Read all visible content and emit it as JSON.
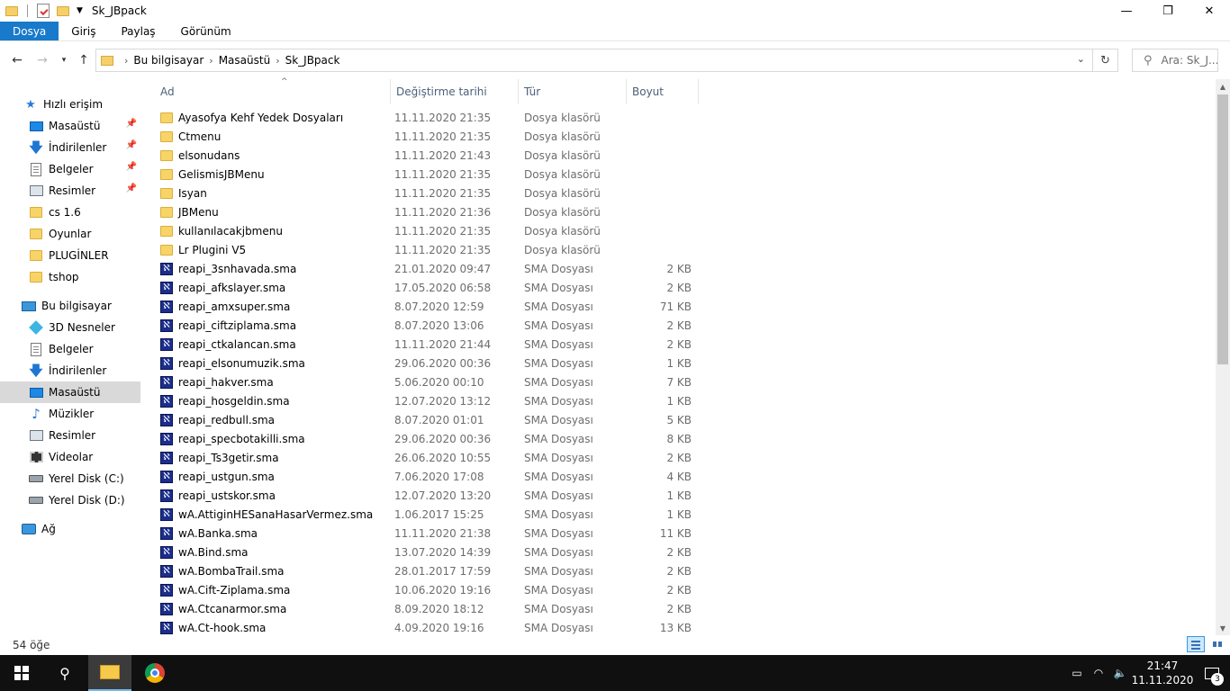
{
  "window": {
    "title": "Sk_JBpack",
    "minimize": "—",
    "maximize": "❐",
    "close": "✕"
  },
  "ribbon": {
    "tabs": [
      {
        "label": "Dosya",
        "active": true
      },
      {
        "label": "Giriş"
      },
      {
        "label": "Paylaş"
      },
      {
        "label": "Görünüm"
      }
    ]
  },
  "address": {
    "crumbs": [
      "Bu bilgisayar",
      "Masaüstü",
      "Sk_JBpack"
    ],
    "search_placeholder": "Ara: Sk_J..."
  },
  "nav": {
    "items": [
      {
        "label": "Hızlı erişim",
        "icon": "star-icon"
      },
      {
        "label": "Masaüstü",
        "icon": "desktop-icon",
        "pinned": true
      },
      {
        "label": "İndirilenler",
        "icon": "download-icon",
        "pinned": true
      },
      {
        "label": "Belgeler",
        "icon": "documents-icon",
        "pinned": true
      },
      {
        "label": "Resimler",
        "icon": "pictures-icon",
        "pinned": true
      },
      {
        "label": "cs 1.6",
        "icon": "folder-icon"
      },
      {
        "label": "Oyunlar",
        "icon": "folder-icon"
      },
      {
        "label": "PLUGİNLER",
        "icon": "folder-icon"
      },
      {
        "label": "tshop",
        "icon": "folder-icon"
      },
      {
        "label": "Bu bilgisayar",
        "icon": "computer-icon"
      },
      {
        "label": "3D Nesneler",
        "icon": "3d-objects-icon"
      },
      {
        "label": "Belgeler",
        "icon": "documents-icon"
      },
      {
        "label": "İndirilenler",
        "icon": "download-icon"
      },
      {
        "label": "Masaüstü",
        "icon": "desktop-icon",
        "selected": true
      },
      {
        "label": "Müzikler",
        "icon": "music-icon"
      },
      {
        "label": "Resimler",
        "icon": "pictures-icon"
      },
      {
        "label": "Videolar",
        "icon": "videos-icon"
      },
      {
        "label": "Yerel Disk (C:)",
        "icon": "disk-icon"
      },
      {
        "label": "Yerel Disk (D:)",
        "icon": "disk-icon"
      },
      {
        "label": "Ağ",
        "icon": "network-icon"
      }
    ]
  },
  "columns": {
    "name": "Ad",
    "date": "Değiştirme tarihi",
    "type": "Tür",
    "size": "Boyut"
  },
  "files": [
    {
      "name": "Ayasofya Kehf Yedek Dosyaları",
      "date": "11.11.2020 21:35",
      "type": "Dosya klasörü",
      "size": "",
      "kind": "folder"
    },
    {
      "name": "Ctmenu",
      "date": "11.11.2020 21:35",
      "type": "Dosya klasörü",
      "size": "",
      "kind": "folder"
    },
    {
      "name": "elsonudans",
      "date": "11.11.2020 21:43",
      "type": "Dosya klasörü",
      "size": "",
      "kind": "folder"
    },
    {
      "name": "GelismisJBMenu",
      "date": "11.11.2020 21:35",
      "type": "Dosya klasörü",
      "size": "",
      "kind": "folder"
    },
    {
      "name": "Isyan",
      "date": "11.11.2020 21:35",
      "type": "Dosya klasörü",
      "size": "",
      "kind": "folder"
    },
    {
      "name": "JBMenu",
      "date": "11.11.2020 21:36",
      "type": "Dosya klasörü",
      "size": "",
      "kind": "folder"
    },
    {
      "name": "kullanılacakjbmenu",
      "date": "11.11.2020 21:35",
      "type": "Dosya klasörü",
      "size": "",
      "kind": "folder"
    },
    {
      "name": "Lr Plugini V5",
      "date": "11.11.2020 21:35",
      "type": "Dosya klasörü",
      "size": "",
      "kind": "folder"
    },
    {
      "name": "reapi_3snhavada.sma",
      "date": "21.01.2020 09:47",
      "type": "SMA Dosyası",
      "size": "2 KB",
      "kind": "sma"
    },
    {
      "name": "reapi_afkslayer.sma",
      "date": "17.05.2020 06:58",
      "type": "SMA Dosyası",
      "size": "2 KB",
      "kind": "sma"
    },
    {
      "name": "reapi_amxsuper.sma",
      "date": "8.07.2020 12:59",
      "type": "SMA Dosyası",
      "size": "71 KB",
      "kind": "sma"
    },
    {
      "name": "reapi_ciftziplama.sma",
      "date": "8.07.2020 13:06",
      "type": "SMA Dosyası",
      "size": "2 KB",
      "kind": "sma"
    },
    {
      "name": "reapi_ctkalancan.sma",
      "date": "11.11.2020 21:44",
      "type": "SMA Dosyası",
      "size": "2 KB",
      "kind": "sma"
    },
    {
      "name": "reapi_elsonumuzik.sma",
      "date": "29.06.2020 00:36",
      "type": "SMA Dosyası",
      "size": "1 KB",
      "kind": "sma"
    },
    {
      "name": "reapi_hakver.sma",
      "date": "5.06.2020 00:10",
      "type": "SMA Dosyası",
      "size": "7 KB",
      "kind": "sma"
    },
    {
      "name": "reapi_hosgeldin.sma",
      "date": "12.07.2020 13:12",
      "type": "SMA Dosyası",
      "size": "1 KB",
      "kind": "sma"
    },
    {
      "name": "reapi_redbull.sma",
      "date": "8.07.2020 01:01",
      "type": "SMA Dosyası",
      "size": "5 KB",
      "kind": "sma"
    },
    {
      "name": "reapi_specbotakilli.sma",
      "date": "29.06.2020 00:36",
      "type": "SMA Dosyası",
      "size": "8 KB",
      "kind": "sma"
    },
    {
      "name": "reapi_Ts3getir.sma",
      "date": "26.06.2020 10:55",
      "type": "SMA Dosyası",
      "size": "2 KB",
      "kind": "sma"
    },
    {
      "name": "reapi_ustgun.sma",
      "date": "7.06.2020 17:08",
      "type": "SMA Dosyası",
      "size": "4 KB",
      "kind": "sma"
    },
    {
      "name": "reapi_ustskor.sma",
      "date": "12.07.2020 13:20",
      "type": "SMA Dosyası",
      "size": "1 KB",
      "kind": "sma"
    },
    {
      "name": "wA.AttiginHESanaHasarVermez.sma",
      "date": "1.06.2017 15:25",
      "type": "SMA Dosyası",
      "size": "1 KB",
      "kind": "sma"
    },
    {
      "name": "wA.Banka.sma",
      "date": "11.11.2020 21:38",
      "type": "SMA Dosyası",
      "size": "11 KB",
      "kind": "sma"
    },
    {
      "name": "wA.Bind.sma",
      "date": "13.07.2020 14:39",
      "type": "SMA Dosyası",
      "size": "2 KB",
      "kind": "sma"
    },
    {
      "name": "wA.BombaTrail.sma",
      "date": "28.01.2017 17:59",
      "type": "SMA Dosyası",
      "size": "2 KB",
      "kind": "sma"
    },
    {
      "name": "wA.Cift-Ziplama.sma",
      "date": "10.06.2020 19:16",
      "type": "SMA Dosyası",
      "size": "2 KB",
      "kind": "sma"
    },
    {
      "name": "wA.Ctcanarmor.sma",
      "date": "8.09.2020 18:12",
      "type": "SMA Dosyası",
      "size": "2 KB",
      "kind": "sma"
    },
    {
      "name": "wA.Ct-hook.sma",
      "date": "4.09.2020 19:16",
      "type": "SMA Dosyası",
      "size": "13 KB",
      "kind": "sma"
    }
  ],
  "status": {
    "item_count": "54 öğe"
  },
  "taskbar": {
    "time": "21:47",
    "date": "11.11.2020",
    "notification_count": "3"
  }
}
